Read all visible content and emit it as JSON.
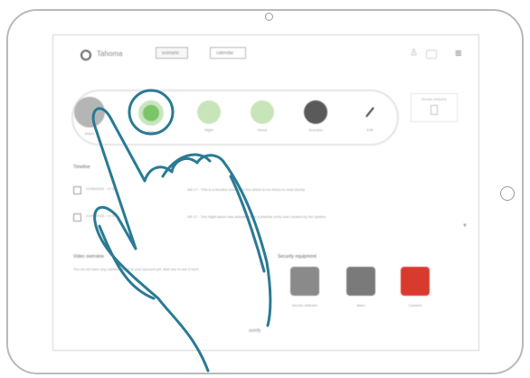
{
  "header": {
    "brand": "Tahoma",
    "tabs": [
      "scenario",
      "calendar"
    ],
    "menu_glyph": "≡"
  },
  "actions": [
    {
      "label": "Alarm",
      "color": "#b5b5b5",
      "icon": "alarm-icon"
    },
    {
      "label": "Away",
      "color": "#7cc46a",
      "icon": "away-icon"
    },
    {
      "label": "Night",
      "color": "#c8e5b9",
      "icon": "night-icon"
    },
    {
      "label": "Home",
      "color": "#c8e5b9",
      "icon": "home-icon"
    },
    {
      "label": "Scenario",
      "color": "#5a5a5a",
      "icon": "gear-icon"
    },
    {
      "label": "Edit",
      "color": "#ffffff",
      "icon": "pencil-icon"
    }
  ],
  "right_panel": {
    "title": "Smoke detector"
  },
  "timeline": {
    "title": "Timeline",
    "rows": [
      {
        "date": "21/08/2016 - 17:54",
        "message": "AM 17 - This is a timeline event text line which is too blurry to read clearly"
      },
      {
        "date": "21/08/2016 - 17:04",
        "message": "DR 17 - The Night alarm was activated and a timeline entry was created by the system"
      }
    ]
  },
  "bottom_left": {
    "title": "Video overview",
    "text": "You do not have any camera linked to your account yet. Add one to see it here."
  },
  "devices": {
    "title": "Security equipment",
    "items": [
      {
        "label": "Smoke detector",
        "color": "#8a8a8a"
      },
      {
        "label": "Siren",
        "color": "#7a7a7a"
      },
      {
        "label": "Camera",
        "color": "#d93a2e"
      }
    ]
  },
  "footer": {
    "text": "somfy"
  },
  "hand_color": "#2a7a94"
}
